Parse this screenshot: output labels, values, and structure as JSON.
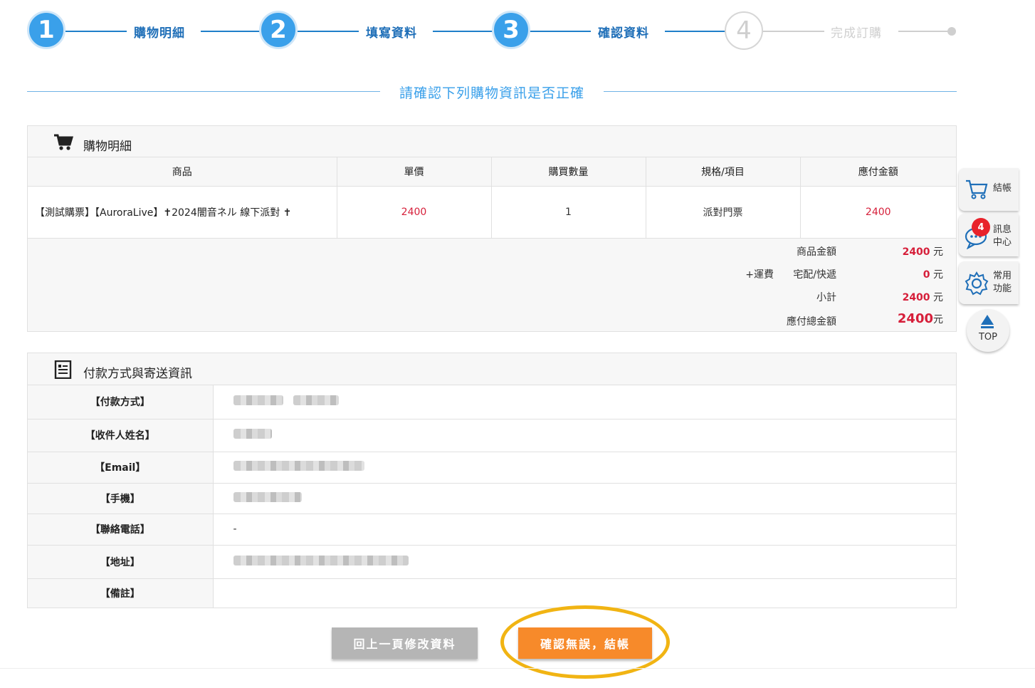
{
  "steps": [
    {
      "number": "1",
      "label": "購物明細"
    },
    {
      "number": "2",
      "label": "填寫資料"
    },
    {
      "number": "3",
      "label": "確認資料"
    },
    {
      "number": "4",
      "label": "完成訂購"
    }
  ],
  "heading": "請確認下列購物資訊是否正確",
  "cart": {
    "title": "購物明細",
    "columns": [
      "商品",
      "單價",
      "購買數量",
      "規格/項目",
      "應付金額"
    ],
    "rows": [
      {
        "product": "【測試購票】【AuroraLive】✝2024闇音ネル 線下派對 ✝",
        "price": "2400",
        "quantity": "1",
        "spec": "派對門票",
        "amount": "2400"
      }
    ],
    "summary": {
      "product_amount_label": "商品金額",
      "product_amount": "2400",
      "shipping_prefix": "+運費",
      "shipping_label": "宅配/快遞",
      "shipping_amount": "0",
      "subtotal_label": "小計",
      "subtotal": "2400",
      "total_label": "應付總金額",
      "total": "2400",
      "currency": "元"
    }
  },
  "info": {
    "title": "付款方式與寄送資訊",
    "rows": [
      {
        "label": "【付款方式】",
        "value": ""
      },
      {
        "label": "【收件人姓名】",
        "value": ""
      },
      {
        "label": "【Email】",
        "value": ""
      },
      {
        "label": "【手機】",
        "value": ""
      },
      {
        "label": "【聯絡電話】",
        "value": "-"
      },
      {
        "label": "【地址】",
        "value": ""
      },
      {
        "label": "【備註】",
        "value": ""
      }
    ]
  },
  "buttons": {
    "back": "回上一頁修改資料",
    "confirm": "確認無誤，結帳"
  },
  "sidebar": {
    "checkout": "結帳",
    "message_center": "訊息中心",
    "message_count": "4",
    "common_functions": "常用功能",
    "top": "TOP"
  },
  "colors": {
    "accent_blue": "#3aa0ea",
    "price_red": "#d61f3a",
    "confirm_orange": "#f78a2a",
    "highlight_yellow": "#f1b413"
  }
}
